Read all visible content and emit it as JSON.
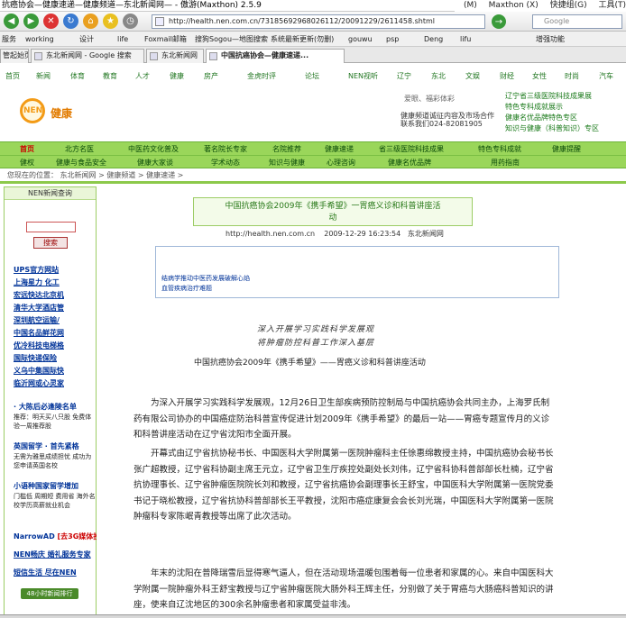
{
  "window": {
    "title": "抗癌协会—健康速递—健康频道—东北新闻网— - 傲游(Maxthon) 2.5.9",
    "menus": [
      "(M)",
      "Maxthon (X)",
      "快捷组(G)",
      "工具(T)"
    ]
  },
  "navbar": {
    "url": "http://health.nen.com.cn/73185692968026112/20091229/2611458.shtml",
    "search_placeholder": "Google"
  },
  "favorites": [
    "服务",
    "working",
    "设计",
    "life",
    "Foxmail邮箱",
    "搜狗Sogou—地图搜索",
    "系统最新更新(勿删)",
    "gouwu",
    "psp",
    "Deng",
    "lifu",
    "增强功能"
  ],
  "tabs": [
    {
      "label": "管起始页"
    },
    {
      "label": "东北新闻网 - Google 搜索"
    },
    {
      "label": "东北新闻网"
    },
    {
      "label": "中国抗癌协会—健康速递...",
      "active": true
    }
  ],
  "site": {
    "topnav": [
      "首页",
      "新闻",
      "体育",
      "教育",
      "人才",
      "健康",
      "房产",
      "金虎时评",
      "论坛",
      "NEN视听",
      "辽宁",
      "东北",
      "文娱",
      "财经",
      "女性",
      "时尚",
      "汽车"
    ],
    "logo_text": "NEN",
    "logo_name": "健康",
    "header_small": "爱眼、福彩体彩",
    "header_info1": "健康频道诚征内容及市场合作",
    "header_info2": "联系我们024-82081905",
    "header_right": [
      "辽宁省三级医院科技成果展",
      "特色专科成就展示",
      "健康名优品牌特色专区",
      "知识与健康（科普知识）专区"
    ],
    "greennav_row1": [
      "首页",
      "北方名医",
      "中医药文化普及",
      "著名院长专家",
      "名院推荐",
      "健康速递",
      "省三级医院科技成果",
      "特色专科成就",
      "健康提醒"
    ],
    "greennav_row2": [
      "健权",
      "健康与食品安全",
      "健康大家谈",
      "学术动态",
      "知识与健康",
      "心理咨询",
      "健康名优品牌",
      "用药指南"
    ],
    "breadcrumb": "您现在的位置： 东北新闻网 > 健康频道 > 健康速递 >"
  },
  "sidebar": {
    "heading": "NEN新闻查询",
    "search_button": "搜索",
    "links": [
      "UPS官方网站",
      "上海星力 化工",
      "宏远快达北京机",
      "清华大学酒店管",
      "深圳航空运输/",
      "中国名品鲜花网",
      "优冷科技电梯格",
      "国际快递保险",
      "义乌中集国际快",
      "临沂网或心灵家"
    ],
    "promo1_title": "· 大陈后必逢陵名单",
    "promo1_text": "推荐：明天买八只股 免费体验一周推荐股",
    "promo2_title": "英国留学 · 首先紧格",
    "promo2_text": "无需为雅思成绩担忧 成功为您申请英国名校",
    "promo3_title": "小语种国家留学增加",
    "promo3_text": "门槛低 周期短 费用省 海外名校学历高薪就业机会",
    "narrowad": "NarrowAD",
    "narrowad_link": "[去3G媒体投放",
    "links2": [
      "NEN畅庆 婚礼服务专家",
      "短信生活 尽在NEN"
    ],
    "bottom_label": "48小时新闻排行"
  },
  "article": {
    "title_line1": "中国抗癌协会2009年《携手希望》一胃癌义诊和科普讲座活",
    "title_line2": "动",
    "url": "http://health.nen.com.cn",
    "date": "2009-12-29 16:23:54",
    "source": "东北新闻网",
    "related": [
      "结病学推动中医药发展破解心焰",
      "血管疾病治疗难题"
    ],
    "subtitle1": "深入开展学习实践科学发展观",
    "subtitle2": "将肿瘤防控科普工作深入基层",
    "headline": "中国抗癌协会2009年《携手希望》——胃癌义诊和科普讲座活动",
    "para1": "为深入开展学习实践科学发展观，12月26日卫生部疾病预防控制局与中国抗癌协会共同主办，上海罗氏制药有限公司协办的中国癌症防治科普宣传促进计划2009年《携手希望》的最后一站——胃癌专题宣传月的义诊和科普讲座活动在辽宁省沈阳市全面开展。",
    "para2": "开幕式由辽宁省抗协秘书长、中国医科大学附属第一医院肿瘤科主任徐惠绵教授主持，中国抗癌协会秘书长张广超教授，辽宁省科协副主席王元立，辽宁省卫生厅疾控处副处长刘伟，辽宁省科协科普部部长杜楠，辽宁省抗协理事长、辽宁省肿瘤医院院长刘和教授，辽宁省抗癌协会副理事长王舒宝，中国医科大学附属第一医院党委书记于晓松教授，辽宁省抗协科普部部长王平教授，沈阳市癌症康复会会长刘光瑞，中国医科大学附属第一医院肿瘤科专家陈岷青教授等出席了此次活动。",
    "para3": "年末的沈阳在普降瑞雪后显得寒气逼人，但在活动现场温暖包围着每一位患者和家属的心。来自中国医科大学附属一院肿瘤外科王舒宝教授与辽宁省肿瘤医院大肠外科王辉主任，分别做了关于胃癌与大肠癌科普知识的讲座，使来自辽沈地区的300余名肿瘤患者和家属受益非浅。"
  },
  "colors": {
    "green_nav": "#9ad65a",
    "link_blue": "#003399",
    "logo_orange": "#f39b16",
    "title_green": "#2a7a1a"
  }
}
